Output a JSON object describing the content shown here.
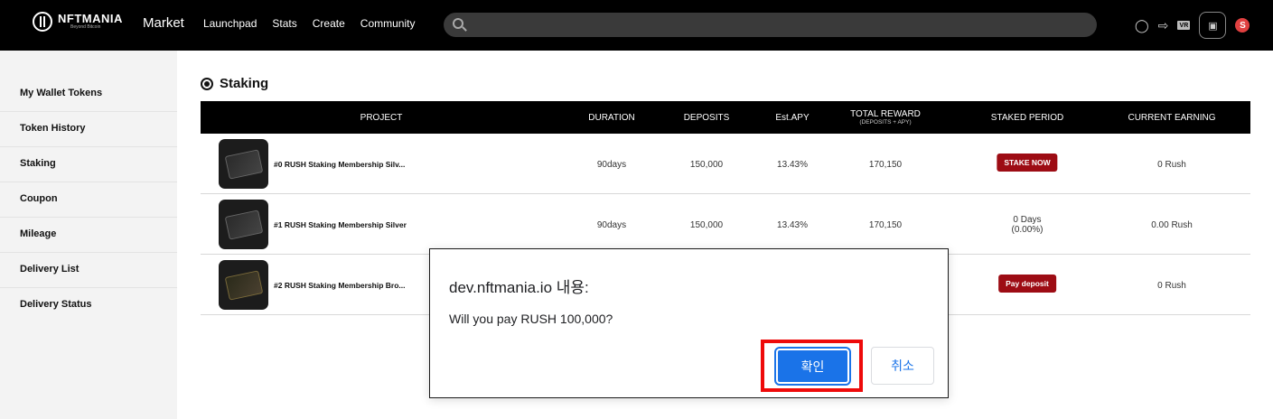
{
  "header": {
    "logo_text": "NFTMANIA",
    "logo_sub": "Beyond Bitcoin",
    "market": "Market",
    "nav": [
      "Launchpad",
      "Stats",
      "Create",
      "Community"
    ],
    "search_placeholder": "",
    "vr_label": "VR",
    "brand_badge": "S"
  },
  "sidebar": {
    "items": [
      "My Wallet Tokens",
      "Token History",
      "Staking",
      "Coupon",
      "Mileage",
      "Delivery List",
      "Delivery Status"
    ]
  },
  "main": {
    "title": "Staking",
    "columns": {
      "project": "PROJECT",
      "duration": "DURATION",
      "deposits": "DEPOSITS",
      "apy": "Est.APY",
      "total_reward": "TOTAL REWARD",
      "total_reward_sub": "(DEPOSITS + APY)",
      "staked_period": "STAKED PERIOD",
      "current_earning": "CURRENT EARNING"
    },
    "rows": [
      {
        "name": "#0 RUSH Staking Membership Silv...",
        "duration": "90days",
        "deposits": "150,000",
        "apy": "13.43%",
        "total": "170,150",
        "period_button": "STAKE NOW",
        "earning": "0 Rush"
      },
      {
        "name": "#1 RUSH Staking Membership Silver",
        "duration": "90days",
        "deposits": "150,000",
        "apy": "13.43%",
        "total": "170,150",
        "period_days": "0 Days",
        "period_pct": "(0.00%)",
        "earning": "0.00 Rush"
      },
      {
        "name": "#2 RUSH Staking Membership Bro...",
        "period_button": "Pay deposit",
        "earning": "0 Rush"
      }
    ]
  },
  "dialog": {
    "title": "dev.nftmania.io 내용:",
    "message": "Will you pay RUSH 100,000?",
    "ok": "확인",
    "cancel": "취소"
  },
  "colors": {
    "header_bg": "#000000",
    "accent_red": "#9d0c14",
    "dialog_blue": "#1a73e8",
    "highlight": "#ee0a0a"
  }
}
